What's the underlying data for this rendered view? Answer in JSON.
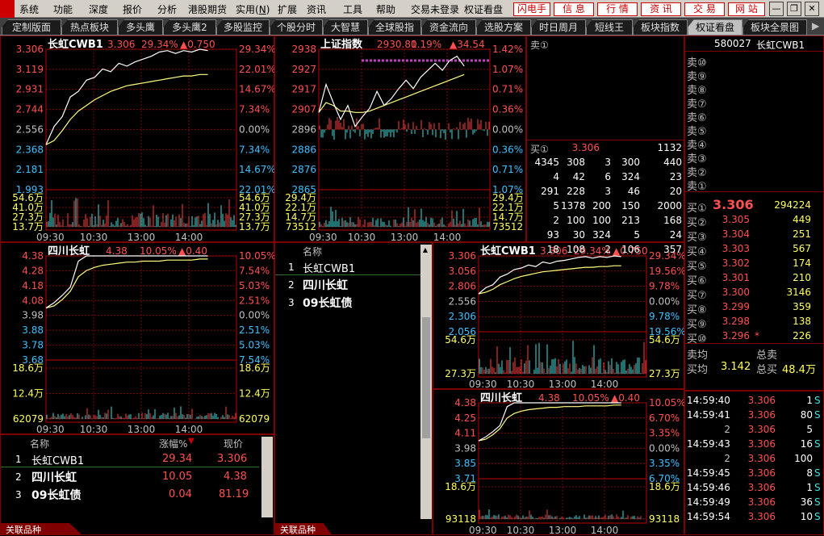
{
  "menubar": {
    "items": [
      "系统",
      "功能",
      "深度",
      "报价",
      "分析",
      "港股期货",
      "实用",
      "扩展",
      "资讯",
      "工具",
      "帮助"
    ],
    "practical_shortcut": "N",
    "trade_status": "交易未登录",
    "right_title": "权证看盘",
    "buttons": [
      "闪电手",
      "信 息",
      "行 情",
      "资 讯",
      "交 易",
      "网 站"
    ]
  },
  "tabs": [
    "定制版面",
    "热点板块",
    "多头鹰",
    "多头鹰2",
    "多股监控",
    "个股分时",
    "大智慧",
    "全球股指",
    "资金流向",
    "选股方案",
    "时日周月",
    "短线王",
    "板块指数",
    "权证看盘",
    "板块全景图"
  ],
  "active_tab": "权证看盘",
  "charts": {
    "cwb1_main": {
      "title": "长虹CWB1",
      "price": "3.306",
      "pct": "29.34%",
      "chg": "▲0.750",
      "left_prices": [
        "3.306",
        "3.119",
        "2.931",
        "2.744",
        "2.556",
        "2.368",
        "2.181",
        "1.993"
      ],
      "right_pcts": [
        "29.34%",
        "22.01%",
        "14.67%",
        "7.34%",
        "0.00%",
        "7.34%",
        "14.67%",
        "22.01%"
      ],
      "vol_left": [
        "54.6万",
        "41.0万",
        "27.3万",
        "13.7万"
      ],
      "vol_right": [
        "54.6万",
        "41.0万",
        "27.3万",
        "13.7万"
      ],
      "times": [
        "09:30",
        "10:30",
        "13:00",
        "14:00"
      ],
      "price_path": [
        0.32,
        0.45,
        0.52,
        0.66,
        0.7,
        0.78,
        0.8,
        0.86,
        0.84,
        0.9,
        0.88,
        0.91,
        0.93,
        0.95,
        0.98,
        0.99,
        0.97,
        0.99,
        0.98,
        1.0,
        0.99
      ],
      "avg_path": [
        0.32,
        0.35,
        0.42,
        0.5,
        0.56,
        0.6,
        0.64,
        0.67,
        0.7,
        0.72,
        0.74,
        0.75,
        0.76,
        0.77,
        0.78,
        0.79,
        0.8,
        0.81,
        0.81,
        0.82,
        0.82
      ]
    },
    "sh_index": {
      "title": "上证指数",
      "price": "2930.80",
      "pct": "1.19%",
      "chg": "▲34.54",
      "left_prices": [
        "2938",
        "2927",
        "2917",
        "2907",
        "2896",
        "2886",
        "2876",
        "2865"
      ],
      "right_pcts": [
        "1.42%",
        "1.07%",
        "0.71%",
        "0.36%",
        "0.00%",
        "0.36%",
        "0.71%",
        "1.07%"
      ],
      "vol_left": [
        "29.4万",
        "22.1万",
        "14.7万",
        "73512"
      ],
      "vol_right": [
        "29.4万",
        "22.1万",
        "14.7万",
        "73512"
      ],
      "times": [
        "09:30",
        "10:30",
        "13:00",
        "14:00"
      ],
      "price_path": [
        0.55,
        0.75,
        0.62,
        0.5,
        0.6,
        0.45,
        0.52,
        0.58,
        0.7,
        0.6,
        0.65,
        0.72,
        0.78,
        0.72,
        0.8,
        0.85,
        0.9,
        0.85,
        0.92,
        0.95,
        0.88
      ],
      "avg_path": [
        0.55,
        0.62,
        0.6,
        0.56,
        0.56,
        0.55,
        0.55,
        0.56,
        0.58,
        0.6,
        0.62,
        0.64,
        0.66,
        0.68,
        0.7,
        0.72,
        0.74,
        0.76,
        0.78,
        0.8,
        0.82
      ]
    },
    "sichuan_left": {
      "title": "四川长虹",
      "price": "4.38",
      "pct": "10.05%",
      "chg": "▲0.40",
      "left_prices": [
        "4.38",
        "4.28",
        "4.18",
        "4.08",
        "3.98",
        "3.88",
        "3.78",
        "3.68"
      ],
      "right_pcts": [
        "10.05%",
        "7.54%",
        "5.03%",
        "2.51%",
        "0.00%",
        "2.51%",
        "5.03%",
        "7.54%"
      ],
      "vol_left": [
        "18.6万",
        "12.4万",
        "62079"
      ],
      "vol_right": [
        "18.6万",
        "12.4万",
        "62079"
      ],
      "times": [
        "09:30",
        "10:30",
        "13:00",
        "14:00"
      ],
      "price_path": [
        0.5,
        0.55,
        0.62,
        0.7,
        0.95,
        1.0,
        1.0,
        1.0,
        1.0,
        1.0,
        1.0,
        1.0,
        1.0,
        1.0,
        1.0,
        1.0,
        1.0,
        1.0,
        1.0,
        1.0,
        1.0
      ],
      "avg_path": [
        0.5,
        0.52,
        0.58,
        0.66,
        0.8,
        0.86,
        0.89,
        0.91,
        0.92,
        0.93,
        0.94,
        0.94,
        0.95,
        0.95,
        0.95,
        0.96,
        0.96,
        0.96,
        0.96,
        0.97,
        0.97
      ]
    },
    "cwb1_small": {
      "title": "长虹CWB1",
      "price": "3.306",
      "pct": "29.34%",
      "chg": "▲0.750",
      "left_prices": [
        "3.306",
        "3.056",
        "2.806",
        "2.556",
        "2.306",
        "2.056"
      ],
      "right_pcts": [
        "29.34%",
        "19.56%",
        "9.78%",
        "0.00%",
        "9.78%",
        "19.56%"
      ],
      "vol_left": [
        "54.6万",
        "27.3万"
      ],
      "vol_right": [
        "54.6万",
        "27.3万"
      ],
      "times": [
        "09:30",
        "10:30",
        "13:00",
        "14:00"
      ],
      "price_path": [
        0.5,
        0.58,
        0.62,
        0.72,
        0.76,
        0.82,
        0.84,
        0.88,
        0.86,
        0.92,
        0.9,
        0.93,
        0.94,
        0.96,
        0.98,
        0.99,
        0.97,
        0.99,
        0.98,
        1.0,
        0.99
      ],
      "avg_path": [
        0.5,
        0.52,
        0.56,
        0.62,
        0.66,
        0.7,
        0.73,
        0.75,
        0.77,
        0.79,
        0.8,
        0.81,
        0.82,
        0.83,
        0.84,
        0.85,
        0.85,
        0.86,
        0.86,
        0.87,
        0.87
      ]
    },
    "sichuan_small": {
      "title": "四川长虹",
      "price": "4.38",
      "pct": "10.05%",
      "chg": "▲0.40",
      "left_prices": [
        "4.38",
        "4.25",
        "4.11",
        "3.98",
        "3.85",
        "3.71"
      ],
      "right_pcts": [
        "10.05%",
        "6.70%",
        "3.35%",
        "0.00%",
        "3.35%",
        "6.70%"
      ],
      "vol_left": [
        "18.6万",
        "93118"
      ],
      "vol_right": [
        "18.6万",
        "93118"
      ],
      "times": [
        "09:30",
        "10:30",
        "13:00",
        "14:00"
      ],
      "price_path": [
        0.5,
        0.55,
        0.62,
        0.7,
        0.95,
        1.0,
        1.0,
        1.0,
        1.0,
        1.0,
        1.0,
        1.0,
        1.0,
        1.0,
        1.0,
        1.0,
        1.0,
        1.0,
        1.0,
        1.0,
        1.0
      ],
      "avg_path": [
        0.5,
        0.52,
        0.58,
        0.66,
        0.8,
        0.86,
        0.89,
        0.91,
        0.92,
        0.93,
        0.94,
        0.94,
        0.95,
        0.95,
        0.95,
        0.96,
        0.96,
        0.96,
        0.96,
        0.97,
        0.97
      ]
    }
  },
  "related_lists": {
    "left": {
      "headers": [
        "名称",
        "涨幅%",
        "现价"
      ],
      "rows": [
        [
          "1",
          "长虹CWB1",
          "29.34",
          "3.306"
        ],
        [
          "2",
          "四川长虹",
          "10.05",
          "4.38"
        ],
        [
          "3",
          "09长虹债",
          "0.04",
          "81.19"
        ]
      ],
      "footer": "关联品种"
    },
    "middle": {
      "header": "名称",
      "rows": [
        [
          "1",
          "长虹CWB1"
        ],
        [
          "2",
          "四川长虹"
        ],
        [
          "3",
          "09长虹债"
        ]
      ],
      "footer": "关联品种"
    }
  },
  "orderbook_left": {
    "sell_label": "卖①",
    "buy_label": "买①",
    "buy_price": "3.306",
    "buy_vol": "1132",
    "grid": [
      [
        "4345",
        "308",
        "3",
        "300",
        "440"
      ],
      [
        "4",
        "42",
        "6",
        "324",
        "23"
      ],
      [
        "291",
        "228",
        "3",
        "46",
        "20"
      ],
      [
        "5",
        "1378",
        "200",
        "150",
        "2000"
      ],
      [
        "2",
        "100",
        "100",
        "213",
        "168"
      ],
      [
        "93",
        "30",
        "324",
        "5",
        "24"
      ],
      [
        "18",
        "108",
        "2",
        "106",
        "357"
      ]
    ]
  },
  "right_panel": {
    "code": "580027",
    "name": "长虹CWB1",
    "sells": [
      "卖⑩",
      "卖⑨",
      "卖⑧",
      "卖⑦",
      "卖⑥",
      "卖⑤",
      "卖④",
      "卖③",
      "卖②",
      "卖①"
    ],
    "buys": [
      [
        "买①",
        "3.306",
        "294224"
      ],
      [
        "买②",
        "3.305",
        "449"
      ],
      [
        "买③",
        "3.304",
        "251"
      ],
      [
        "买④",
        "3.303",
        "567"
      ],
      [
        "买⑤",
        "3.302",
        "174"
      ],
      [
        "买⑥",
        "3.301",
        "210"
      ],
      [
        "买⑦",
        "3.300",
        "3146"
      ],
      [
        "买⑧",
        "3.299",
        "359"
      ],
      [
        "买⑨",
        "3.298",
        "138"
      ],
      [
        "买⑩",
        "3.296",
        "226"
      ]
    ],
    "mark_star": "*",
    "sell_avg_label": "卖均",
    "total_sell_label": "总卖",
    "buy_avg_label": "买均",
    "buy_avg": "3.142",
    "total_buy_label": "总买",
    "total_buy": "48.4万",
    "ticks": [
      [
        "14:59:40",
        "3.306",
        "1",
        "S"
      ],
      [
        "14:59:41",
        "3.306",
        "80",
        "S"
      ],
      [
        "",
        "2",
        "3.306",
        "5"
      ],
      [
        "14:59:43",
        "3.306",
        "16",
        "S"
      ],
      [
        "",
        "2",
        "3.306",
        "100"
      ],
      [
        "14:59:45",
        "3.306",
        "8",
        "S"
      ],
      [
        "14:59:46",
        "3.306",
        "1",
        "S"
      ],
      [
        "14:59:49",
        "3.306",
        "36",
        "S"
      ],
      [
        "14:59:54",
        "3.306",
        "10",
        "S"
      ]
    ]
  }
}
